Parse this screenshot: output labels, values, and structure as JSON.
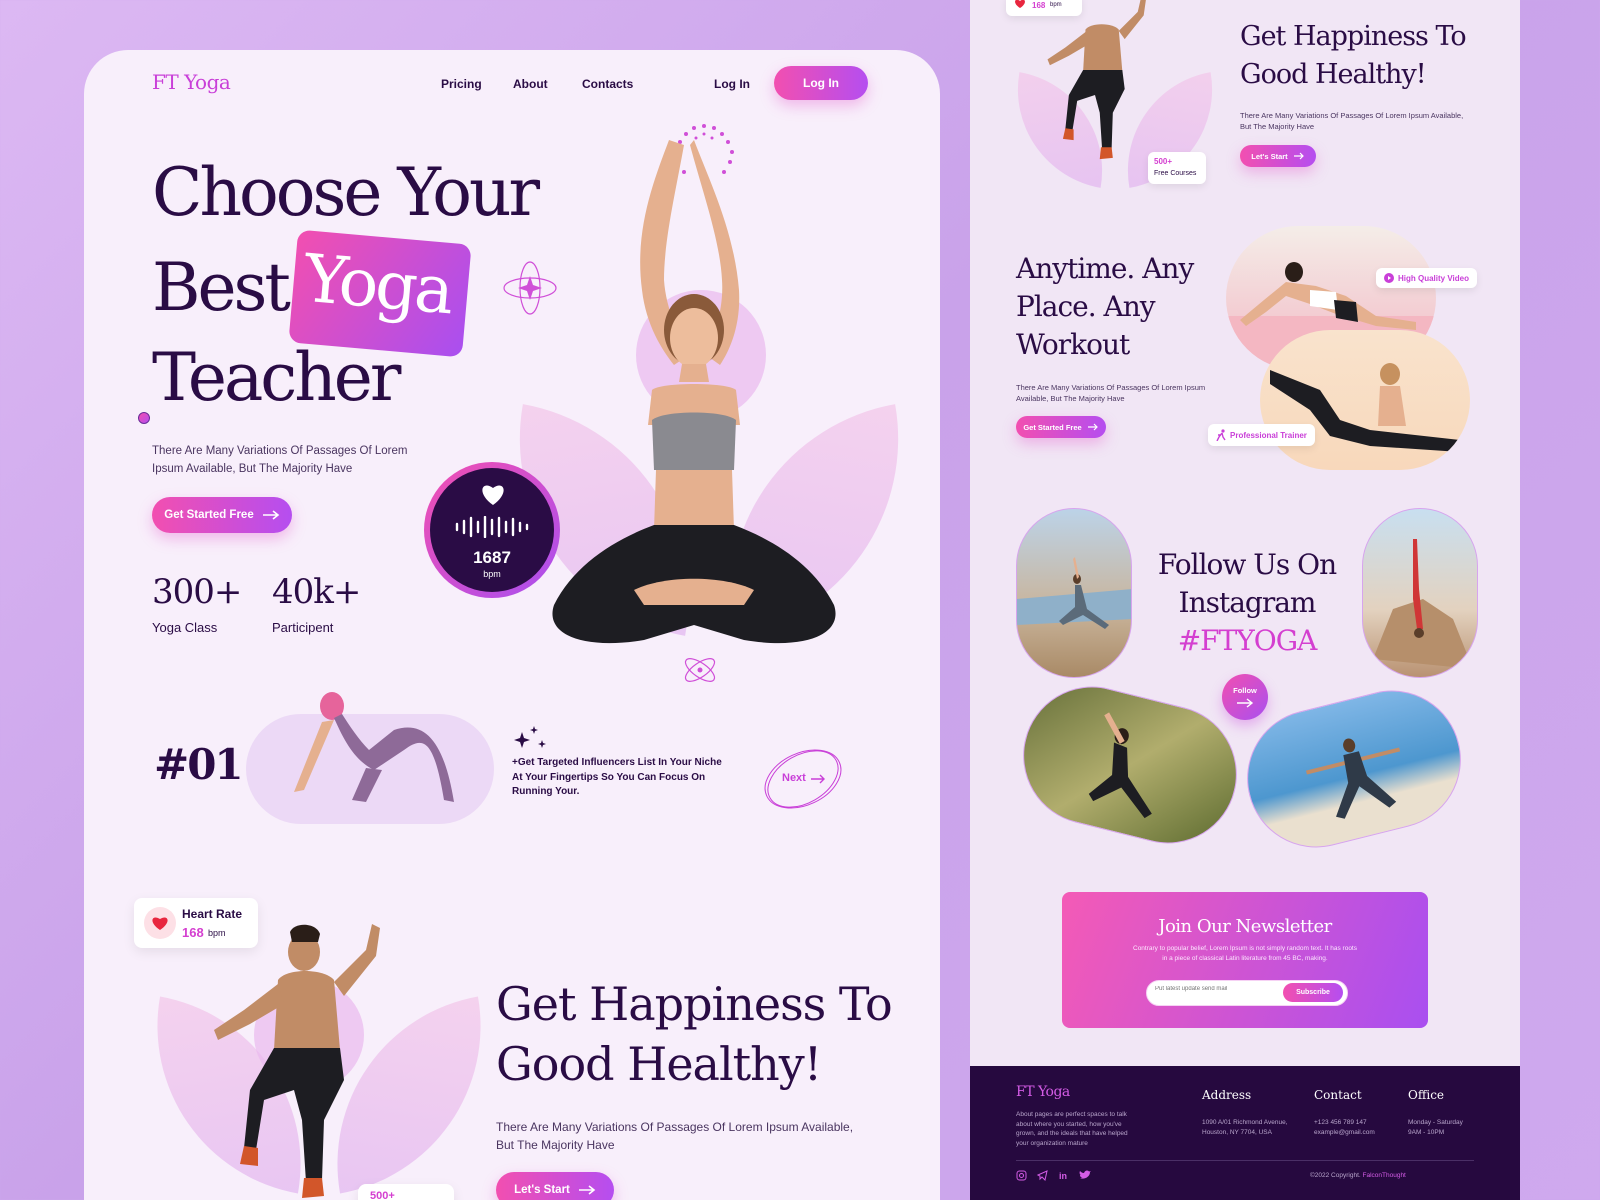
{
  "brand": {
    "logo": "FT Yoga"
  },
  "nav": {
    "items": [
      "Pricing",
      "About",
      "Contacts"
    ],
    "login_link": "Log In",
    "login_button": "Log In"
  },
  "hero": {
    "line1": "Choose Your",
    "line2a": "Best",
    "line2b": "Yoga",
    "line3": "Teacher",
    "description": "There Are Many Variations Of Passages Of Lorem Ipsum Available, But The Majority Have",
    "cta": "Get Started Free",
    "stats": [
      {
        "value": "300+",
        "label": "Yoga Class"
      },
      {
        "value": "40k+",
        "label": "Participent"
      }
    ],
    "heart_widget": {
      "value": "1687",
      "unit": "bpm"
    }
  },
  "feature": {
    "number": "#01",
    "text": "+Get Targeted Influencers List In Your Niche At Your Fingertips So You Can Focus On Running Your.",
    "next": "Next"
  },
  "happiness": {
    "title_line1": "Get Happiness To",
    "title_line2": "Good Healthy!",
    "description": "There Are Many Variations Of Passages Of Lorem Ipsum Available, But The Majority Have",
    "cta": "Let's Start",
    "heart_rate": {
      "label": "Heart Rate",
      "value": "168",
      "unit": "bpm"
    },
    "courses_badge": "500+"
  },
  "right": {
    "top_badge": {
      "value": "168",
      "unit": "bpm"
    },
    "happiness": {
      "title_line1": "Get Happiness To",
      "title_line2": "Good Healthy!",
      "description": "There Are Many Variations Of Passages Of Lorem Ipsum Available, But The Majority Have",
      "cta": "Let's Start",
      "courses_value": "500+",
      "courses_label": "Free Courses"
    },
    "anytime": {
      "title_line1": "Anytime. Any",
      "title_line2": "Place. Any",
      "title_line3": "Workout",
      "description": "There Are Many Variations Of Passages Of Lorem Ipsum Available, But The Majority Have",
      "cta": "Get Started Free",
      "tag_video": "High Quality Video",
      "tag_trainer": "Professional Trainer"
    },
    "instagram": {
      "line1": "Follow Us On",
      "line2": "Instagram",
      "hashtag": "#FTYOGA",
      "follow": "Follow"
    },
    "newsletter": {
      "title": "Join Our Newsletter",
      "text": "Contrary to popular belief, Lorem Ipsum is not simply random text. It has roots in a piece of classical Latin literature from 45 BC, making.",
      "placeholder": "Put latest update send mail",
      "button": "Subscribe"
    },
    "footer": {
      "logo": "FT Yoga",
      "about": "About pages are perfect spaces to talk about where you started, how you've grown, and the ideals that have helped your organization mature",
      "address_title": "Address",
      "address": "1090 A/01 Richmond Avenue, Houston, NY 7704, USA",
      "contact_title": "Contact",
      "phone": "+123 456 789 147",
      "email": "example@gmail.com",
      "office_title": "Office",
      "office_days": "Monday - Saturday",
      "office_hours": "9AM - 10PM",
      "copyright": "©2022 Copyright.",
      "copyright_brand": "FalconThought"
    }
  },
  "colors": {
    "accent_pink": "#f24fb0",
    "accent_purple": "#b54ef0",
    "dark": "#2a0c45",
    "footer_bg": "#26093f"
  },
  "icons": [
    "arrow-right-icon",
    "heart-icon",
    "sparkle-icon",
    "play-icon",
    "runner-icon",
    "instagram-icon",
    "telegram-icon",
    "linkedin-icon",
    "twitter-icon"
  ]
}
